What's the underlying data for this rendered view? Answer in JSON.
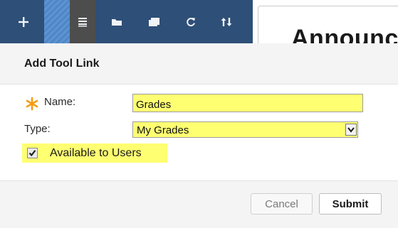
{
  "toolbar": {
    "buttons": [
      {
        "icon": "plus-icon"
      },
      {
        "icon": "striped-handle"
      },
      {
        "icon": "list-icon"
      },
      {
        "icon": "folder-icon"
      },
      {
        "icon": "window-icon"
      },
      {
        "icon": "refresh-icon"
      },
      {
        "icon": "sort-arrows-icon"
      }
    ]
  },
  "background_page": {
    "title": "Announc"
  },
  "dialog": {
    "title": "Add Tool Link",
    "required_mark_color": "#f39c12",
    "highlight_color": "#ffff72",
    "name_field": {
      "label": "Name:",
      "value": "Grades"
    },
    "type_field": {
      "label": "Type:",
      "selected": "My Grades"
    },
    "available": {
      "label": "Available to Users",
      "checked": true
    },
    "buttons": {
      "cancel": "Cancel",
      "submit": "Submit"
    }
  }
}
